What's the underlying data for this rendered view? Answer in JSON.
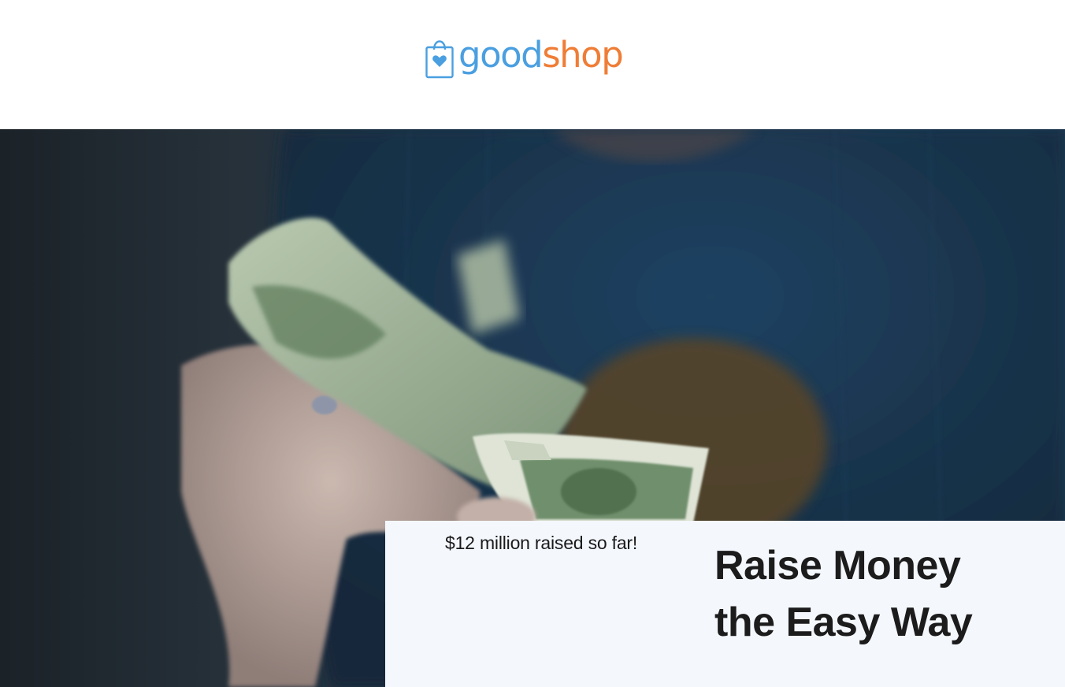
{
  "brand": {
    "name_part1": "good",
    "name_part2": "shop",
    "logo_icon": "shopping-bag-heart-icon",
    "colors": {
      "primary_blue": "#4a9fe0",
      "accent_orange": "#ef7d36"
    }
  },
  "hero": {
    "image_subject": "hands-counting-dollar-bills"
  },
  "promo": {
    "raised_text": "$12 million raised so far!",
    "headline_line1": "Raise Money",
    "headline_line2": "the Easy Way"
  }
}
